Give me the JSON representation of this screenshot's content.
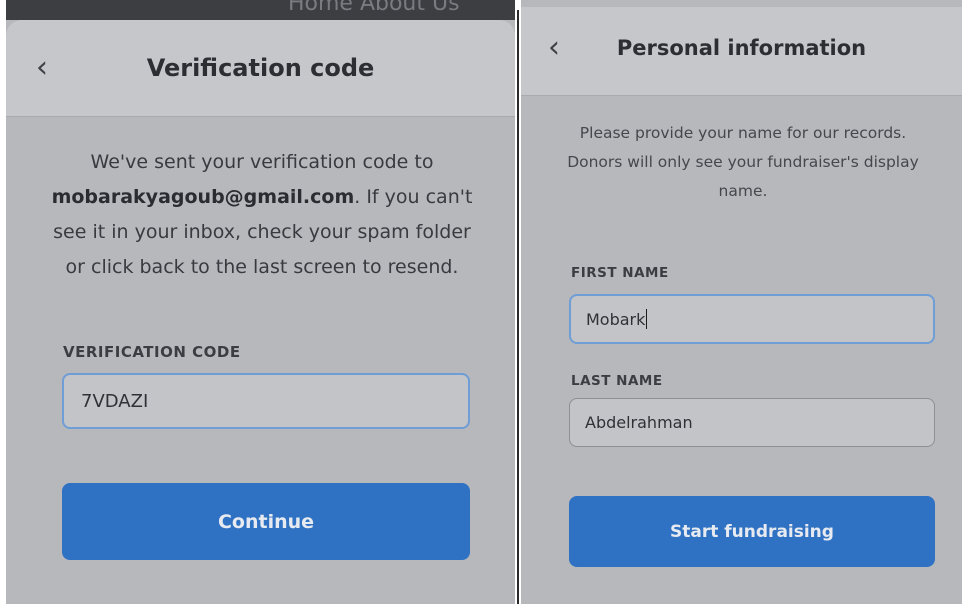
{
  "left_panel": {
    "top_strip_text": "Home  About Us",
    "back_icon": "chevron-left-icon",
    "back_glyph": "‹",
    "title": "Verification code",
    "message_prefix": "We've sent your verification code to",
    "email": "mobarakyagoub@gmail.com",
    "message_suffix": ". If you can't see it in your inbox, check your spam folder or click back to the last screen to resend.",
    "code_label": "VERIFICATION CODE",
    "code_value": "7VDAZI",
    "continue_label": "Continue"
  },
  "right_panel": {
    "back_icon": "chevron-left-icon",
    "back_glyph": "‹",
    "title": "Personal information",
    "message": "Please provide your name for our records. Donors will only see your fundraiser's display name.",
    "first_name_label": "FIRST NAME",
    "first_name_value": "Mobark",
    "last_name_label": "LAST NAME",
    "last_name_value": "Abdelrahman",
    "start_label": "Start fundraising"
  },
  "colors": {
    "overlay_gray": "#b7b8bc",
    "accent_blue": "#2f71c2",
    "focus_border": "#6f9dd6"
  }
}
